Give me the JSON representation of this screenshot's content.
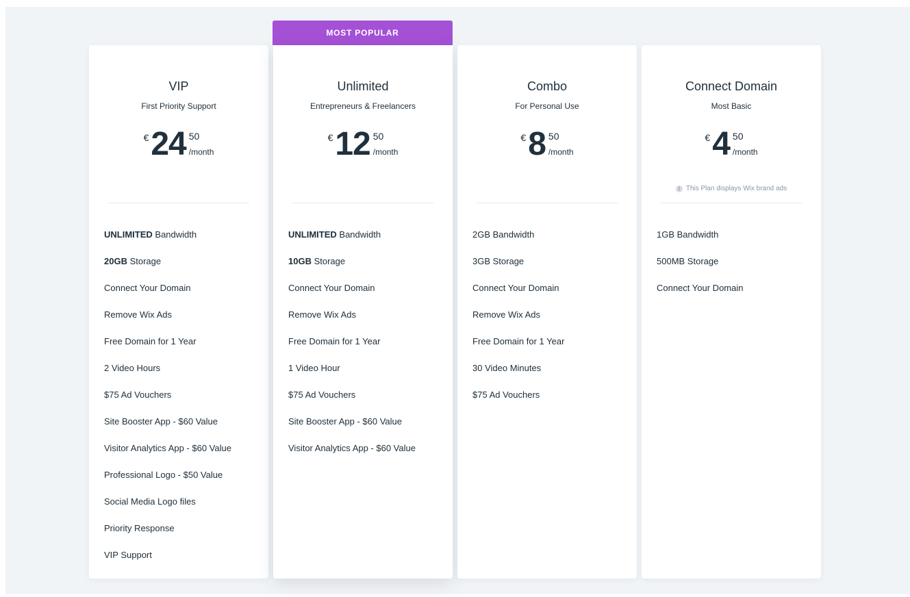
{
  "badge": "MOST POPULAR",
  "note": "This Plan displays Wix brand ads",
  "plans": [
    {
      "name": "VIP",
      "tagline": "First Priority Support",
      "currency": "€",
      "amount": "24",
      "cents": "50",
      "period": "/month",
      "features": [
        {
          "strong": "UNLIMITED",
          "text": " Bandwidth"
        },
        {
          "strong": "20GB",
          "text": " Storage"
        },
        {
          "strong": "",
          "text": "Connect Your Domain"
        },
        {
          "strong": "",
          "text": "Remove Wix Ads"
        },
        {
          "strong": "",
          "text": "Free Domain for 1 Year"
        },
        {
          "strong": "",
          "text": "2 Video Hours"
        },
        {
          "strong": "",
          "text": "$75 Ad Vouchers"
        },
        {
          "strong": "",
          "text": "Site Booster App - $60 Value"
        },
        {
          "strong": "",
          "text": "Visitor Analytics App - $60 Value"
        },
        {
          "strong": "",
          "text": "Professional Logo - $50 Value"
        },
        {
          "strong": "",
          "text": "Social Media Logo files"
        },
        {
          "strong": "",
          "text": "Priority Response"
        },
        {
          "strong": "",
          "text": "VIP Support"
        }
      ]
    },
    {
      "name": "Unlimited",
      "tagline": "Entrepreneurs & Freelancers",
      "currency": "€",
      "amount": "12",
      "cents": "50",
      "period": "/month",
      "features": [
        {
          "strong": "UNLIMITED",
          "text": " Bandwidth"
        },
        {
          "strong": "10GB",
          "text": " Storage"
        },
        {
          "strong": "",
          "text": "Connect Your Domain"
        },
        {
          "strong": "",
          "text": "Remove Wix Ads"
        },
        {
          "strong": "",
          "text": "Free Domain for 1 Year"
        },
        {
          "strong": "",
          "text": "1 Video Hour"
        },
        {
          "strong": "",
          "text": "$75 Ad Vouchers"
        },
        {
          "strong": "",
          "text": "Site Booster App - $60 Value"
        },
        {
          "strong": "",
          "text": "Visitor Analytics App - $60 Value"
        }
      ]
    },
    {
      "name": "Combo",
      "tagline": "For Personal Use",
      "currency": "€",
      "amount": "8",
      "cents": "50",
      "period": "/month",
      "features": [
        {
          "strong": "",
          "text": "2GB Bandwidth"
        },
        {
          "strong": "",
          "text": "3GB Storage"
        },
        {
          "strong": "",
          "text": "Connect Your Domain"
        },
        {
          "strong": "",
          "text": "Remove Wix Ads"
        },
        {
          "strong": "",
          "text": "Free Domain for 1 Year"
        },
        {
          "strong": "",
          "text": "30 Video Minutes"
        },
        {
          "strong": "",
          "text": "$75 Ad Vouchers"
        }
      ]
    },
    {
      "name": "Connect Domain",
      "tagline": "Most Basic",
      "currency": "€",
      "amount": "4",
      "cents": "50",
      "period": "/month",
      "features": [
        {
          "strong": "",
          "text": "1GB Bandwidth"
        },
        {
          "strong": "",
          "text": "500MB Storage"
        },
        {
          "strong": "",
          "text": "Connect Your Domain"
        }
      ]
    }
  ]
}
